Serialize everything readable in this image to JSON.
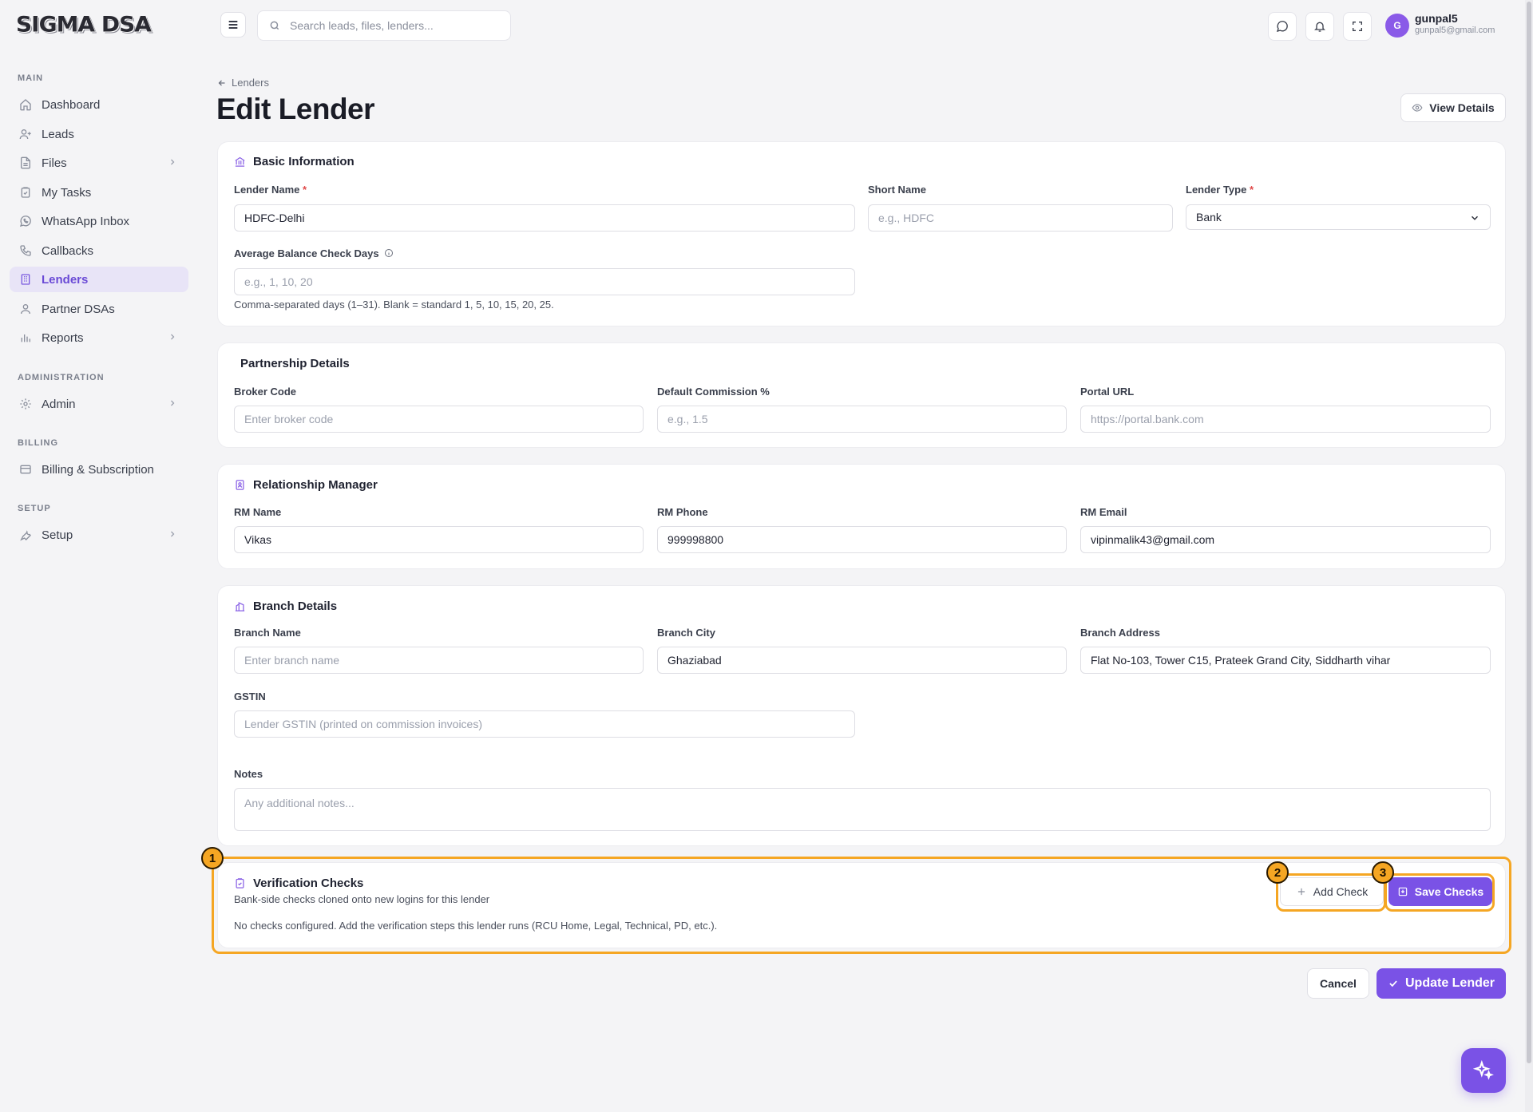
{
  "app": {
    "logo": "SIGMA DSA"
  },
  "topbar": {
    "search_placeholder": "Search leads, files, lenders...",
    "user_initial": "G",
    "user_name": "gunpal5",
    "user_email": "gunpal5@gmail.com"
  },
  "sidebar": {
    "sections": {
      "main": "MAIN",
      "administration": "ADMINISTRATION",
      "billing": "BILLING",
      "setup": "SETUP"
    },
    "items": {
      "dashboard": "Dashboard",
      "leads": "Leads",
      "files": "Files",
      "my_tasks": "My Tasks",
      "whatsapp_inbox": "WhatsApp Inbox",
      "callbacks": "Callbacks",
      "lenders": "Lenders",
      "partner_dsas": "Partner DSAs",
      "reports": "Reports",
      "admin": "Admin",
      "billing_subscription": "Billing & Subscription",
      "setup": "Setup"
    }
  },
  "header": {
    "breadcrumb": "Lenders",
    "title": "Edit Lender",
    "view_details": "View Details"
  },
  "basic_info": {
    "title": "Basic Information",
    "lender_name_label": "Lender Name",
    "lender_name_value": "HDFC-Delhi",
    "short_name_label": "Short Name",
    "short_name_placeholder": "e.g., HDFC",
    "lender_type_label": "Lender Type",
    "lender_type_value": "Bank",
    "avg_days_label": "Average Balance Check Days",
    "avg_days_placeholder": "e.g., 1, 10, 20",
    "avg_days_hint": "Comma-separated days (1–31). Blank = standard 1, 5, 10, 15, 20, 25."
  },
  "partnership": {
    "title": "Partnership Details",
    "broker_code_label": "Broker Code",
    "broker_code_placeholder": "Enter broker code",
    "commission_label": "Default Commission %",
    "commission_placeholder": "e.g., 1.5",
    "portal_label": "Portal URL",
    "portal_placeholder": "https://portal.bank.com"
  },
  "rm": {
    "title": "Relationship Manager",
    "name_label": "RM Name",
    "name_value": "Vikas",
    "phone_label": "RM Phone",
    "phone_value": "999998800",
    "email_label": "RM Email",
    "email_value": "vipinmalik43@gmail.com"
  },
  "branch": {
    "title": "Branch Details",
    "name_label": "Branch Name",
    "name_placeholder": "Enter branch name",
    "city_label": "Branch City",
    "city_value": "Ghaziabad",
    "address_label": "Branch Address",
    "address_value": "Flat No-103, Tower C15, Prateek Grand City, Siddharth vihar",
    "gstin_label": "GSTIN",
    "gstin_placeholder": "Lender GSTIN (printed on commission invoices)",
    "notes_label": "Notes",
    "notes_placeholder": "Any additional notes..."
  },
  "verification": {
    "title": "Verification Checks",
    "subtitle": "Bank-side checks cloned onto new logins for this lender",
    "empty": "No checks configured. Add the verification steps this lender runs (RCU Home, Legal, Technical, PD, etc.).",
    "add_check": "Add Check",
    "save_checks": "Save Checks"
  },
  "footer": {
    "cancel": "Cancel",
    "update": "Update Lender"
  },
  "annotations": {
    "badge_1": "1",
    "badge_2": "2",
    "badge_3": "3"
  },
  "colors": {
    "accent": "#7a52e6",
    "highlight": "#f5a623",
    "active_bg": "#e8e4f7"
  }
}
